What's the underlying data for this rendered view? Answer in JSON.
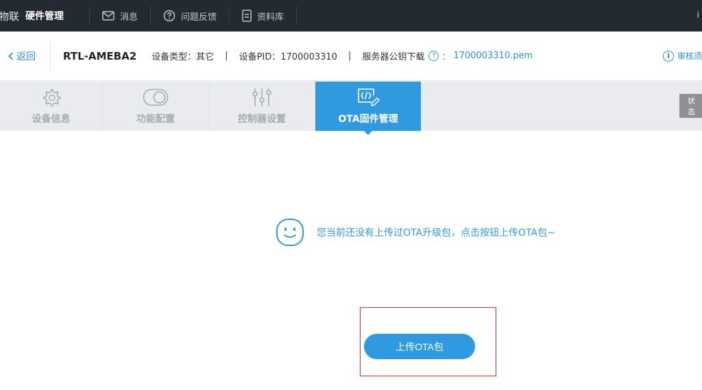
{
  "topnav": {
    "brand_prefix": "物联",
    "brand_title": "硬件管理",
    "items": [
      {
        "label": "消息",
        "icon": "mail-icon"
      },
      {
        "label": "问题反馈",
        "icon": "question-circle-icon"
      },
      {
        "label": "资料库",
        "icon": "document-icon"
      }
    ],
    "right_glyph": "i"
  },
  "infobar": {
    "back_label": "返回",
    "device_name": "RTL-AMEBA2",
    "device_type": "设备类型：其它",
    "separator": "|",
    "device_pid": "设备PID：1700003310",
    "server_key_label": "服务器公钥下载",
    "server_key_colon": "：",
    "server_key_file": "1700003310.pem",
    "audit_label": "审核须"
  },
  "tabs": [
    {
      "label": "设备信息",
      "icon": "gear-icon",
      "active": false
    },
    {
      "label": "功能配置",
      "icon": "toggle-icon",
      "active": false
    },
    {
      "label": "控制器设置",
      "icon": "sliders-icon",
      "active": false
    },
    {
      "label": "OTA固件管理",
      "icon": "code-edit-icon",
      "active": true
    }
  ],
  "status_button": "状态",
  "empty_state": {
    "icon": "smiley-icon",
    "message": "您当前还没有上传过OTA升级包，点击按钮上传OTA包~"
  },
  "upload_button": "上传OTA包",
  "colors": {
    "nav_bg": "#232a31",
    "accent": "#2f9ae0",
    "link": "#2b8fd6",
    "highlight": "#e02b2b"
  }
}
